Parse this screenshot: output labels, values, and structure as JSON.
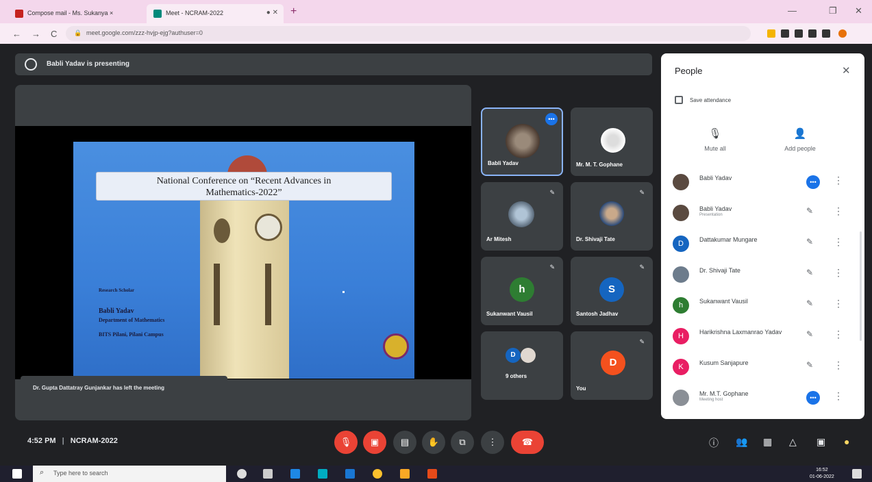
{
  "browser": {
    "tabs": [
      {
        "title": "Compose mail - Ms. Sukanya ×"
      },
      {
        "title": "Meet - NCRAM-2022"
      }
    ],
    "url": "meet.google.com/zzz-hvjp-ejg?authuser=0",
    "new_tab": "+",
    "minimize": "—",
    "restore": "❐",
    "close": "✕",
    "back": "←",
    "forward": "→",
    "reload": "C"
  },
  "meet": {
    "presenting_banner": "Babli Yadav is presenting",
    "slide": {
      "title_line1": "National Conference on “Recent Advances in",
      "title_line2": "Mathematics-2022”",
      "role": "Research Scholar",
      "name": "Babli Yadav",
      "dept": "Department of Mathematics",
      "inst": "BITS Pilani, Pilani Campus"
    },
    "toast": "Dr. Gupta Dattatray Gunjankar has left the meeting",
    "tiles": [
      {
        "name": "Babli Yadav"
      },
      {
        "name": "Mr. M. T. Gophane"
      },
      {
        "name": "Ar Mitesh"
      },
      {
        "name": "Dr. Shivaji Tate"
      },
      {
        "name": "Sukanwant Vausil",
        "initial": "h"
      },
      {
        "name": "Santosh Jadhav",
        "initial": "S"
      },
      {
        "name": "9 others"
      },
      {
        "name": "You",
        "initial": "D"
      }
    ],
    "time": "4:52 PM",
    "separator": "|",
    "meeting_code": "NCRAM-2022"
  },
  "people": {
    "title": "People",
    "close": "✕",
    "save_attendance": "Save attendance",
    "mute_all": "Mute all",
    "add_people": "Add people",
    "participants": [
      {
        "name": "Babli Yadav",
        "sub": "",
        "initial": "",
        "color": "#5a4a40"
      },
      {
        "name": "Babli Yadav",
        "sub": "Presentation",
        "initial": "",
        "color": "#5a4a40"
      },
      {
        "name": "Dattakumar Mungare",
        "sub": "",
        "initial": "D",
        "color": "#1565c0"
      },
      {
        "name": "Dr. Shivaji Tate",
        "sub": "",
        "initial": "",
        "color": "#6d7c8c"
      },
      {
        "name": "Sukanwant Vausil",
        "sub": "",
        "initial": "h",
        "color": "#2e7d32"
      },
      {
        "name": "Harikrishna Laxmanrao Yadav",
        "sub": "",
        "initial": "H",
        "color": "#e91e63"
      },
      {
        "name": "Kusum Sanjapure",
        "sub": "",
        "initial": "K",
        "color": "#e91e63"
      },
      {
        "name": "Mr. M.T. Gophane",
        "sub": "Meeting host",
        "initial": "",
        "color": "#8a8f96"
      }
    ]
  },
  "taskbar": {
    "search_placeholder": "Type here to search",
    "time": "16:52",
    "date": "01-06-2022"
  },
  "colors": {
    "accent": "#1a73e8",
    "danger": "#ea4335",
    "bg": "#202124",
    "tile": "#3c4043"
  }
}
